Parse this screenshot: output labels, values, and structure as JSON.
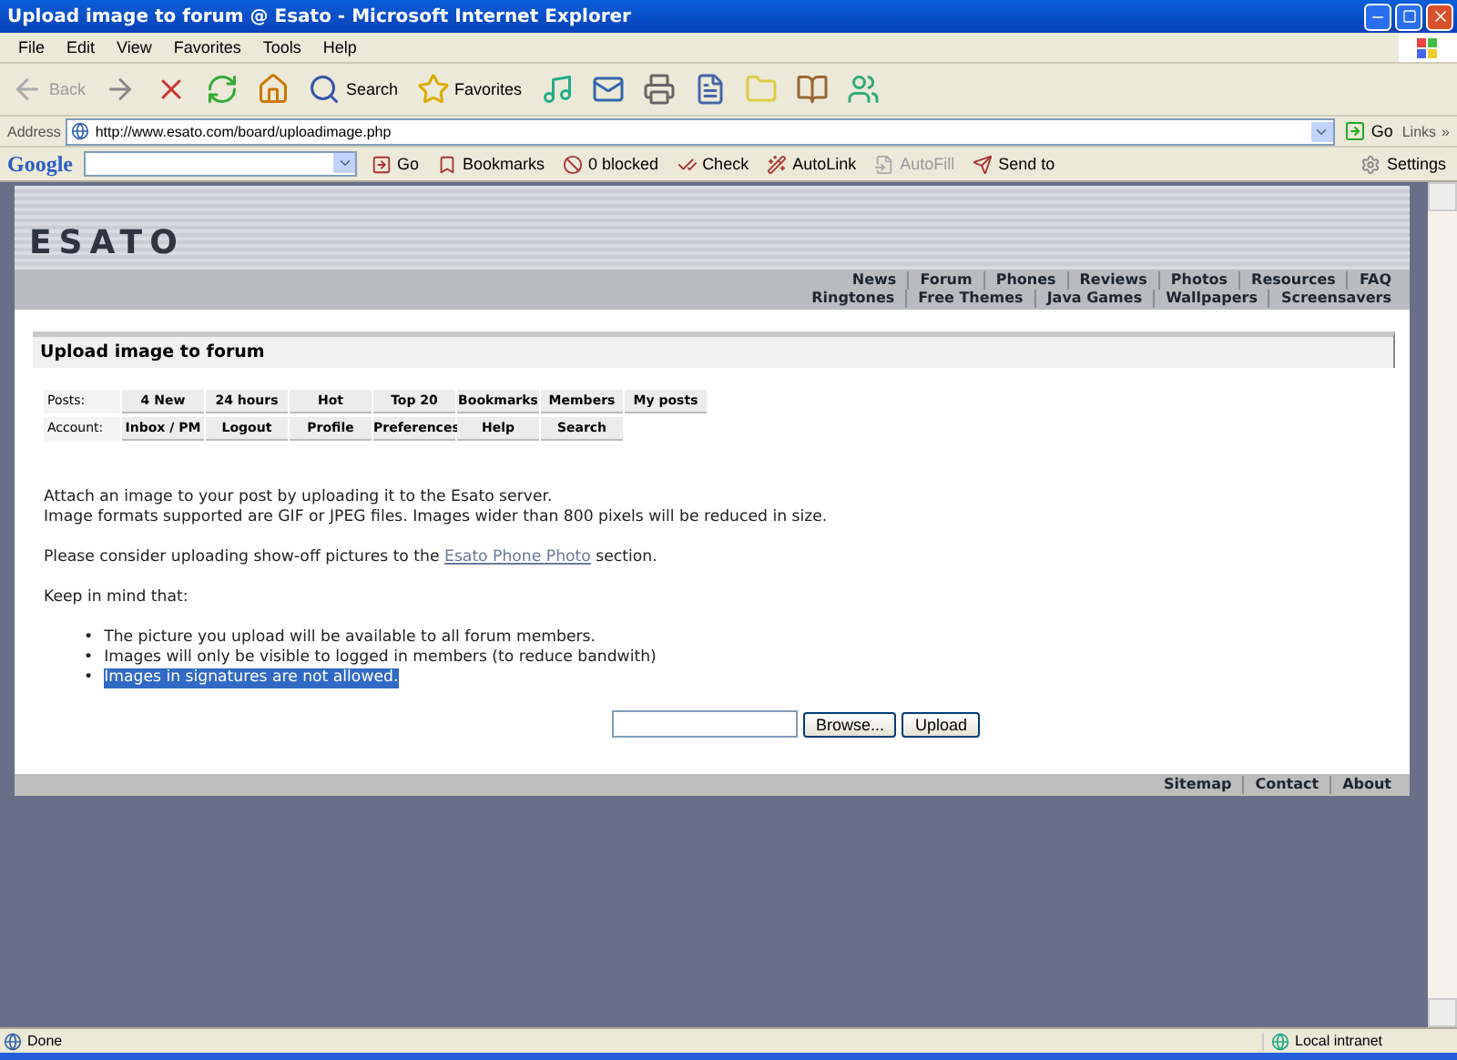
{
  "window": {
    "title": "Upload image to forum @ Esato - Microsoft Internet Explorer"
  },
  "menu": [
    "File",
    "Edit",
    "View",
    "Favorites",
    "Tools",
    "Help"
  ],
  "toolbar": [
    {
      "kind": "back",
      "label": "Back",
      "disabled": true
    },
    {
      "kind": "forward",
      "disabled": false
    },
    {
      "kind": "stop"
    },
    {
      "kind": "refresh"
    },
    {
      "kind": "home"
    },
    {
      "kind": "search",
      "label": "Search"
    },
    {
      "kind": "favorites",
      "label": "Favorites"
    },
    {
      "kind": "media"
    },
    {
      "kind": "mail"
    },
    {
      "kind": "print"
    },
    {
      "kind": "edit"
    },
    {
      "kind": "folder"
    },
    {
      "kind": "research"
    },
    {
      "kind": "messenger"
    }
  ],
  "address": {
    "label": "Address",
    "url": "http://www.esato.com/board/uploadimage.php",
    "go": "Go",
    "links": "Links",
    "more": "»"
  },
  "google": {
    "brand": "Google",
    "items": [
      {
        "kind": "go",
        "label": "Go",
        "disabled": false
      },
      {
        "kind": "bookmarks",
        "label": "Bookmarks",
        "disabled": false
      },
      {
        "kind": "blocked",
        "label": "0 blocked",
        "disabled": false
      },
      {
        "kind": "check",
        "label": "Check",
        "disabled": false
      },
      {
        "kind": "autolink",
        "label": "AutoLink",
        "disabled": false
      },
      {
        "kind": "autofill",
        "label": "AutoFill",
        "disabled": true
      },
      {
        "kind": "sendto",
        "label": "Send to",
        "disabled": false
      }
    ],
    "settings": "Settings"
  },
  "site": {
    "logo": "ESATO",
    "nav_rows": [
      [
        "News",
        "Forum",
        "Phones",
        "Reviews",
        "Photos",
        "Resources",
        "FAQ"
      ],
      [
        "Ringtones",
        "Free Themes",
        "Java Games",
        "Wallpapers",
        "Screensavers"
      ]
    ],
    "heading": "Upload image to forum",
    "quick_nav": [
      {
        "label": "Posts:",
        "buttons": [
          "4 New",
          "24 hours",
          "Hot",
          "Top 20",
          "Bookmarks",
          "Members",
          "My posts"
        ]
      },
      {
        "label": "Account:",
        "buttons": [
          "Inbox / PM",
          "Logout",
          "Profile",
          "Preferences",
          "Help",
          "Search"
        ]
      }
    ],
    "intro_lines": [
      "Attach an image to your post by uploading it to the Esato server.",
      "Image formats supported are GIF or JPEG files. Images wider than 800 pixels will be reduced in size."
    ],
    "photo_note": {
      "before": "Please consider uploading show-off pictures to the",
      "link": "Esato Phone Photo",
      "after": "section."
    },
    "keep_in_mind": "Keep in mind that:",
    "rules": [
      {
        "marker": "•",
        "text": "The picture you upload will be available to all forum members.",
        "selected": false
      },
      {
        "marker": "•",
        "text": "Images will only be visible to logged in members (to reduce bandwith)",
        "selected": false
      },
      {
        "marker": "•",
        "text": "Images in signatures are not allowed.",
        "selected": true
      }
    ],
    "upload": {
      "browse": "Browse...",
      "submit": "Upload"
    },
    "footer_links": [
      "Sitemap",
      "Contact",
      "About"
    ]
  },
  "status_bar": {
    "text": "Done",
    "zone": "Local intranet"
  }
}
